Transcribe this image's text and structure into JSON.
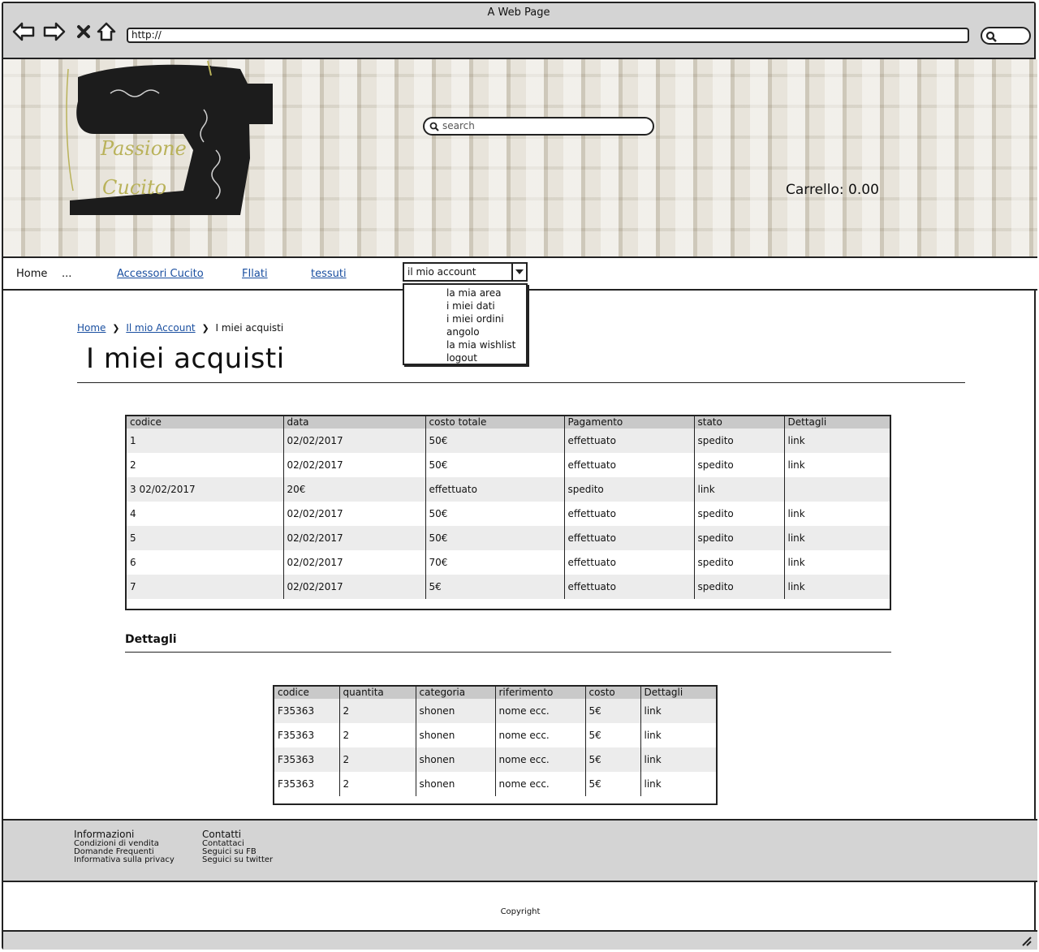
{
  "window": {
    "title": "A Web Page",
    "url": "http://"
  },
  "banner": {
    "logo_text_line1": "Passione",
    "logo_text_line2": "Cucito",
    "search_placeholder": "search",
    "cart": "Carrello: 0.00"
  },
  "nav": {
    "home": "Home",
    "ellipsis": "...",
    "accessori": "Accessori Cucito",
    "filati": "FIlati",
    "tessuti": "tessuti",
    "account_select": "il mio account",
    "dropdown": [
      "la mia area",
      "i miei dati",
      "i miei ordini",
      "angolo",
      "la mia wishlist",
      "logout"
    ]
  },
  "breadcrumb": {
    "home": "Home",
    "account": "Il mio Account",
    "current": "I miei acquisti"
  },
  "page_title": "I miei acquisti",
  "orders_table": {
    "headers": [
      "codice",
      "data",
      "costo totale",
      "Pagamento",
      "stato",
      "Dettagli"
    ],
    "rows": [
      [
        "1",
        "02/02/2017",
        "50€",
        "effettuato",
        "spedito",
        "link"
      ],
      [
        "2",
        "02/02/2017",
        "50€",
        "effettuato",
        "spedito",
        "link"
      ],
      [
        "3 02/02/2017",
        "20€",
        "effettuato",
        "spedito",
        "link",
        ""
      ],
      [
        "4",
        "02/02/2017",
        "50€",
        "effettuato",
        "spedito",
        "link"
      ],
      [
        "5",
        "02/02/2017",
        "50€",
        "effettuato",
        "spedito",
        "link"
      ],
      [
        "6",
        "02/02/2017",
        "70€",
        "effettuato",
        "spedito",
        "link"
      ],
      [
        "7",
        "02/02/2017",
        "5€",
        "effettuato",
        "spedito",
        "link"
      ]
    ]
  },
  "details_title": "Dettagli",
  "details_table": {
    "headers": [
      "codice",
      "quantita",
      "categoria",
      "riferimento",
      "costo",
      "Dettagli"
    ],
    "rows": [
      [
        "F35363",
        "2",
        "shonen",
        "nome ecc.",
        "5€",
        "link"
      ],
      [
        "F35363",
        "2",
        "shonen",
        "nome ecc.",
        "5€",
        "link"
      ],
      [
        "F35363",
        "2",
        "shonen",
        "nome ecc.",
        "5€",
        "link"
      ],
      [
        "F35363",
        "2",
        "shonen",
        "nome ecc.",
        "5€",
        "link"
      ]
    ]
  },
  "footer": {
    "info_title": "Informazioni",
    "info_links": [
      "Condizioni di vendita",
      "Domande Frequenti",
      "Informativa sulla privacy"
    ],
    "contact_title": "Contatti",
    "contact_links": [
      "Contattaci",
      "Seguici su FB",
      "Seguici su twitter"
    ],
    "copyright": "Copyright"
  },
  "icons": {
    "back": "back-arrow-icon",
    "forward": "forward-arrow-icon",
    "stop": "close-icon",
    "home": "home-icon",
    "search": "search-icon",
    "dropdown": "chevron-down-icon",
    "resize": "resize-grip-icon"
  }
}
